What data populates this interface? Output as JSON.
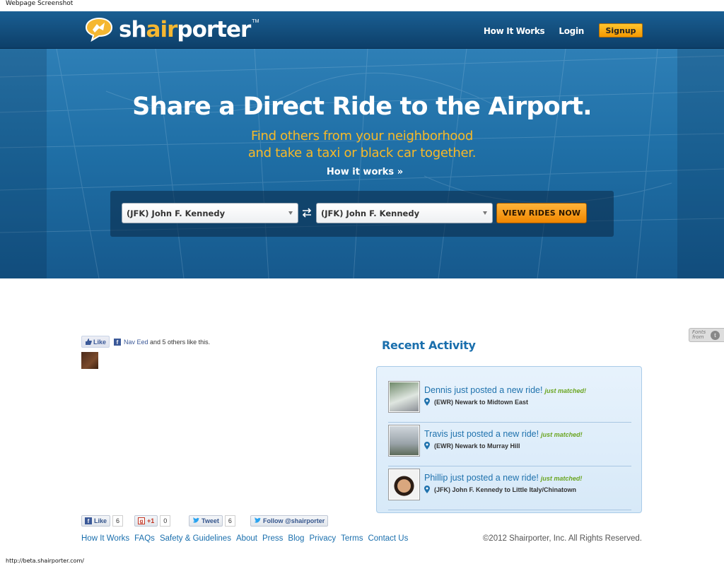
{
  "caption": "Webpage Screenshot",
  "status_url": "http://beta.shairporter.com/",
  "header": {
    "logo_prefix": "sh",
    "logo_highlight": "air",
    "logo_suffix": "porter",
    "logo_tm": "TM",
    "nav": {
      "how_it_works": "How It Works",
      "login": "Login",
      "signup": "Signup"
    }
  },
  "hero": {
    "title": "Share a Direct Ride to the Airport.",
    "subtitle_line1": "Find others from your neighborhood",
    "subtitle_line2": "and take a taxi or black car together.",
    "how_link": "How it works »",
    "from_select": "(JFK) John F. Kennedy",
    "to_select": "(JFK) John F. Kennedy",
    "view_button": "VIEW RIDES NOW"
  },
  "facebook": {
    "like_label": "Like",
    "friend_name": "Nav Eed",
    "like_text": " and 5 others like this."
  },
  "recent": {
    "title": "Recent Activity",
    "items": [
      {
        "title": "Dennis just posted a new ride!",
        "badge": "just matched!",
        "route": "(EWR) Newark to Midtown East"
      },
      {
        "title": "Travis just posted a new ride!",
        "badge": "just matched!",
        "route": "(EWR) Newark to Murray Hill"
      },
      {
        "title": "Phillip just posted a new ride!",
        "badge": "just matched!",
        "route": "(JFK) John F. Kennedy to Little Italy/Chinatown"
      }
    ]
  },
  "fonts_badge": {
    "line1": "Fonts",
    "line2": "from"
  },
  "social": {
    "like_label": "Like",
    "like_count": "6",
    "plusone_label": "+1",
    "plusone_count": "0",
    "tweet_label": "Tweet",
    "tweet_count": "6",
    "follow_label": "Follow @shairporter"
  },
  "footer": {
    "links": [
      "How It Works",
      "FAQs",
      "Safety & Guidelines",
      "About",
      "Press",
      "Blog",
      "Privacy",
      "Terms",
      "Contact Us"
    ],
    "copyright": "©2012 Shairporter, Inc. All Rights Reserved."
  },
  "colors": {
    "header_bg": "#0d3f69",
    "hero_bg": "#1f6fa6",
    "accent_orange": "#f39800",
    "subtitle_yellow": "#f7b928",
    "link_blue": "#1a6fad",
    "matched_green": "#6aa520"
  }
}
